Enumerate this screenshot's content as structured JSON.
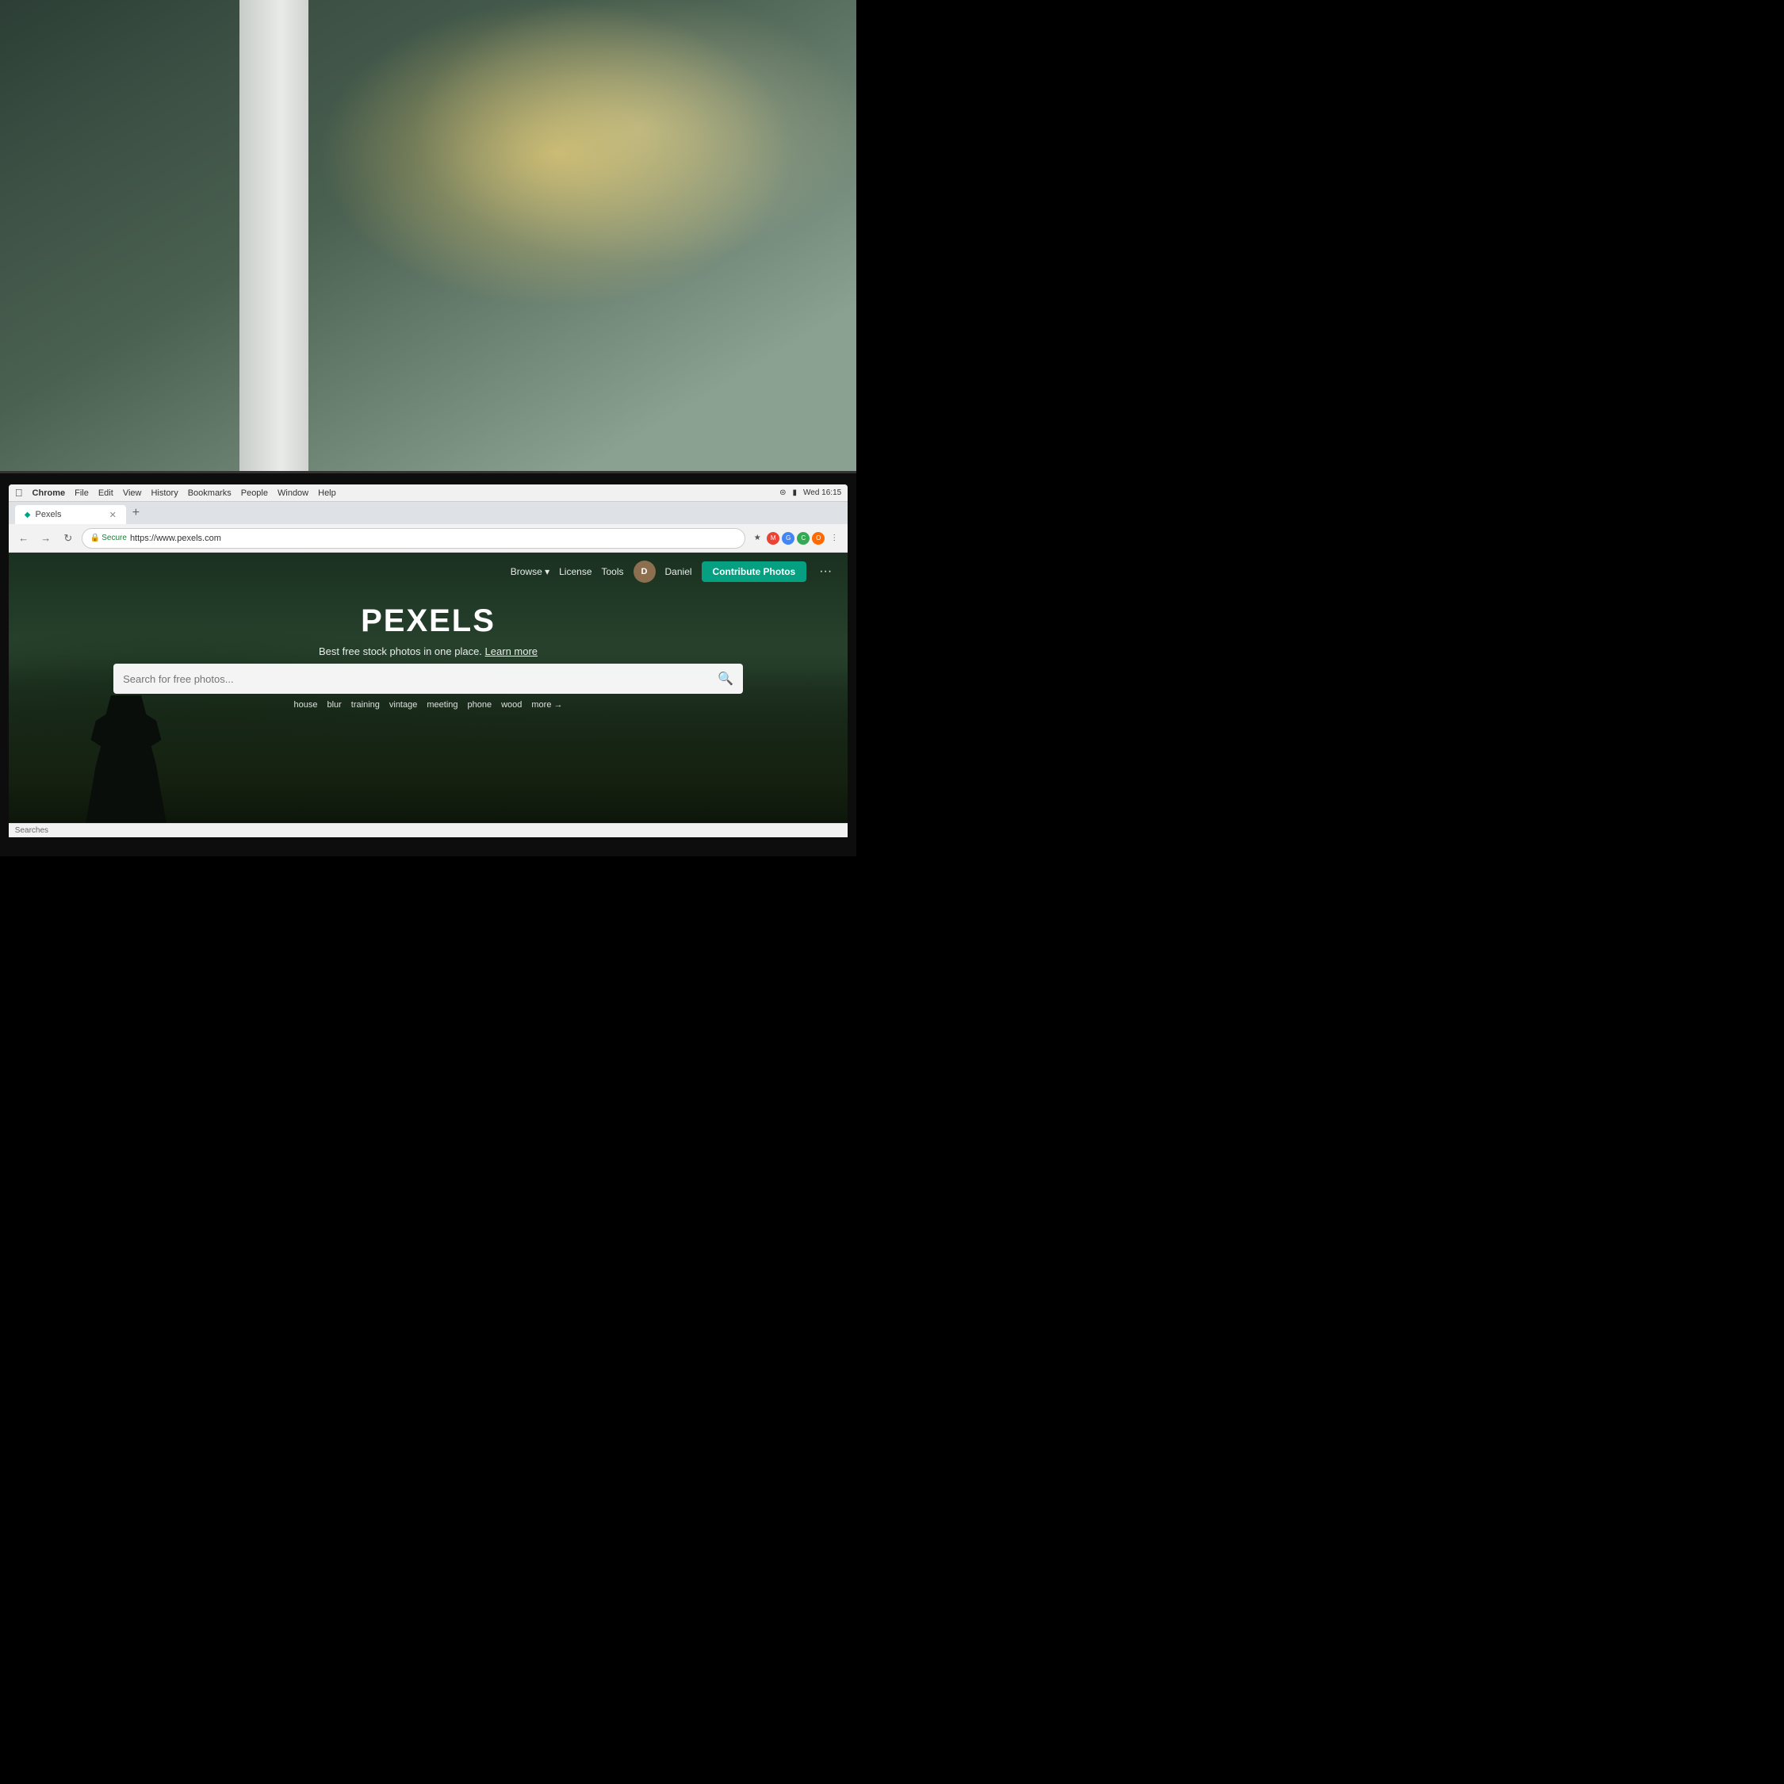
{
  "background": {
    "description": "Office environment with blurred background, bokeh light effects"
  },
  "os": {
    "menubar": {
      "app": "Chrome",
      "menus": [
        "File",
        "Edit",
        "View",
        "History",
        "Bookmarks",
        "People",
        "Window",
        "Help"
      ],
      "time": "Wed 16:15",
      "battery": "100%"
    }
  },
  "browser": {
    "tab": {
      "title": "Pexels",
      "favicon": "●"
    },
    "address": {
      "secure_label": "Secure",
      "url": "https://www.pexels.com"
    },
    "status_bar": {
      "text": "Searches"
    }
  },
  "pexels": {
    "nav": {
      "browse_label": "Browse",
      "license_label": "License",
      "tools_label": "Tools",
      "user_name": "Daniel",
      "contribute_label": "Contribute Photos",
      "more_icon": "···"
    },
    "hero": {
      "logo": "PEXELS",
      "tagline": "Best free stock photos in one place.",
      "learn_more": "Learn more",
      "search_placeholder": "Search for free photos...",
      "tags": [
        "house",
        "blur",
        "training",
        "vintage",
        "meeting",
        "phone",
        "wood"
      ],
      "more_label": "more →"
    }
  }
}
